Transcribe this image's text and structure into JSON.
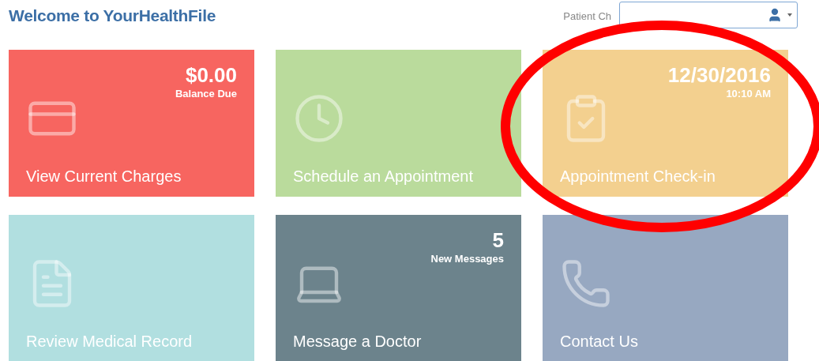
{
  "header": {
    "title": "Welcome to YourHealthFile",
    "patient_label": "Patient Ch"
  },
  "tiles": [
    {
      "label": "View Current Charges",
      "color": "#f76560",
      "info": "$0.00",
      "info_sub": "Balance Due"
    },
    {
      "label": "Schedule an Appointment",
      "color": "#badb9c"
    },
    {
      "label": "Appointment Check-in",
      "color": "#f3d08f",
      "info": "12/30/2016",
      "info_sub": "10:10 AM"
    },
    {
      "label": "Review Medical Record",
      "color": "#b1dfe0"
    },
    {
      "label": "Message a Doctor",
      "color": "#6c838c",
      "info": "5",
      "info_sub": "New Messages"
    },
    {
      "label": "Contact Us",
      "color": "#97a8c1"
    }
  ],
  "annotation": {
    "kind": "ellipse",
    "color": "#ff0000"
  }
}
